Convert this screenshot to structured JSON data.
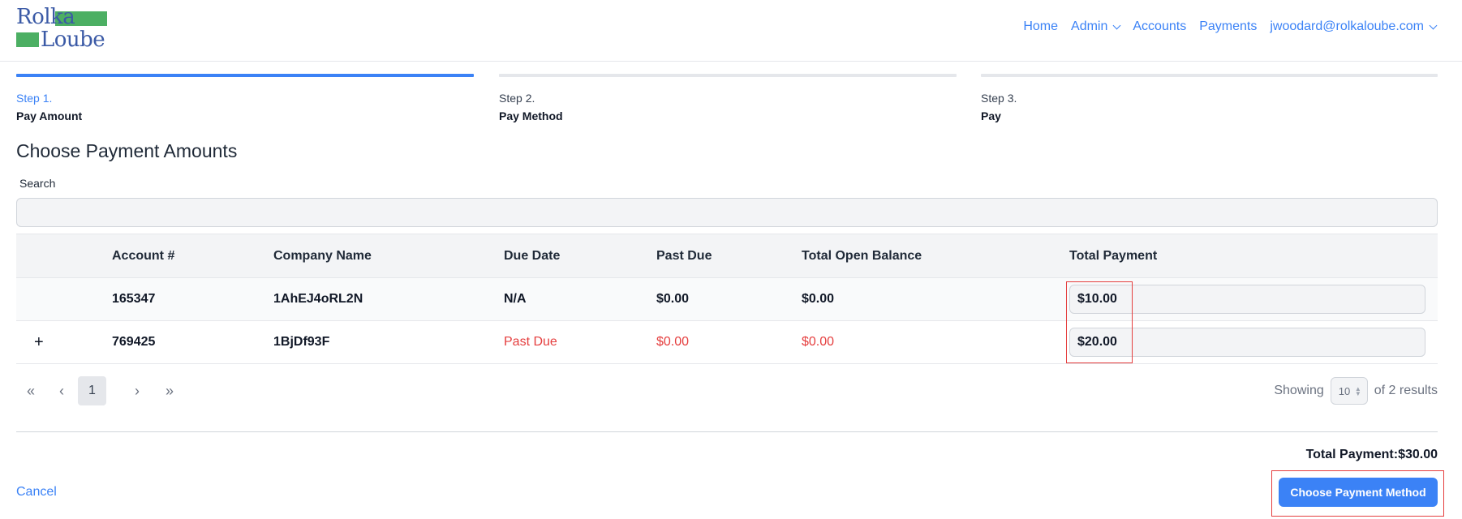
{
  "logo": {
    "line1": "Rolka",
    "line2": "Loube"
  },
  "nav": {
    "home": "Home",
    "admin": "Admin",
    "accounts": "Accounts",
    "payments": "Payments",
    "user": "jwoodard@rolkaloube.com"
  },
  "steps": [
    {
      "number": "Step 1.",
      "label": "Pay Amount",
      "active": true
    },
    {
      "number": "Step 2.",
      "label": "Pay Method",
      "active": false
    },
    {
      "number": "Step 3.",
      "label": "Pay",
      "active": false
    }
  ],
  "page_title": "Choose Payment Amounts",
  "search": {
    "label": "Search",
    "value": ""
  },
  "table": {
    "headers": [
      "",
      "Account #",
      "Company Name",
      "Due Date",
      "Past Due",
      "Total Open Balance",
      "Total Payment"
    ],
    "rows": [
      {
        "expand": "",
        "account": "165347",
        "company": "1AhEJ4oRL2N",
        "due_date": "N/A",
        "past_due": "$0.00",
        "open_balance": "$0.00",
        "payment": "$10.00",
        "overdue": false
      },
      {
        "expand": "+",
        "account": "769425",
        "company": "1BjDf93F",
        "due_date": "Past Due",
        "past_due": "$0.00",
        "open_balance": "$0.00",
        "payment": "$20.00",
        "overdue": true
      }
    ]
  },
  "pagination": {
    "first": "«",
    "prev": "‹",
    "current_page": "1",
    "next": "›",
    "last": "»",
    "showing_label": "Showing",
    "page_size": "10",
    "results_label": "of 2 results"
  },
  "summary": {
    "total_label": "Total Payment:",
    "total_value": "$30.00"
  },
  "actions": {
    "cancel": "Cancel",
    "next": "Choose Payment Method"
  },
  "colors": {
    "accent": "#3b82f6",
    "danger": "#e53e3e",
    "logo_green": "#4caf63",
    "logo_blue": "#3b5aa6"
  }
}
